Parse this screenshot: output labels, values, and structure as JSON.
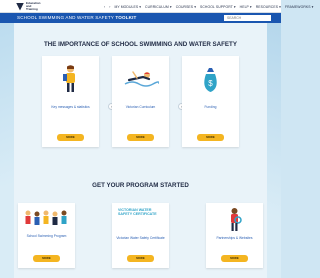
{
  "topbar": {
    "logo_text": "Education and Training",
    "nav": [
      "‹",
      "›",
      "MY MODULES ▾",
      "CURRICULUM ▾",
      "COURSES ▾",
      "SCHOOL SUPPORT ▾",
      "HELP ▾",
      "RESOURCES ▾",
      "FRAMEWORKS ▾"
    ]
  },
  "toolbar": {
    "title_prefix": "SCHOOL SWIMMING AND WATER SAFETY",
    "title_suffix": "TOOLKIT",
    "search_placeholder": "SEARCH"
  },
  "section1": {
    "title": "THE IMPORTANCE OF SCHOOL SWIMMING AND WATER SAFETY",
    "cards": [
      {
        "label": "Key messages & statistics",
        "button": "MORE"
      },
      {
        "label": "Victorian Curriculum",
        "button": "MORE"
      },
      {
        "label": "Funding",
        "button": "MORE"
      }
    ]
  },
  "section2": {
    "title": "GET YOUR PROGRAM STARTED",
    "cards": [
      {
        "label": "School Swimming Program",
        "button": "MORE"
      },
      {
        "label": "Victorian Water Safety Certificate",
        "button": "MORE",
        "cert_text": "VICTORIAN WATER SAFETY CERTIFICATE"
      },
      {
        "label": "Partnerships & Websites",
        "button": "MORE"
      }
    ]
  },
  "colors": {
    "nav_blue": "#1a56b0",
    "button_yellow": "#f4b521",
    "link_blue": "#2a5fb3",
    "heading": "#1f2a44"
  }
}
